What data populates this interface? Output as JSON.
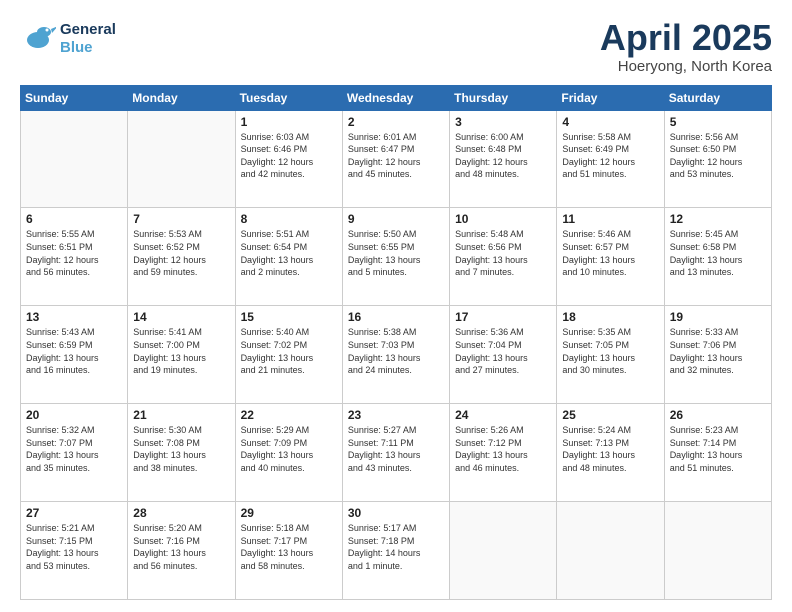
{
  "logo": {
    "line1": "General",
    "line2": "Blue"
  },
  "title": "April 2025",
  "subtitle": "Hoeryong, North Korea",
  "days_header": [
    "Sunday",
    "Monday",
    "Tuesday",
    "Wednesday",
    "Thursday",
    "Friday",
    "Saturday"
  ],
  "weeks": [
    [
      {
        "day": "",
        "info": ""
      },
      {
        "day": "",
        "info": ""
      },
      {
        "day": "1",
        "info": "Sunrise: 6:03 AM\nSunset: 6:46 PM\nDaylight: 12 hours\nand 42 minutes."
      },
      {
        "day": "2",
        "info": "Sunrise: 6:01 AM\nSunset: 6:47 PM\nDaylight: 12 hours\nand 45 minutes."
      },
      {
        "day": "3",
        "info": "Sunrise: 6:00 AM\nSunset: 6:48 PM\nDaylight: 12 hours\nand 48 minutes."
      },
      {
        "day": "4",
        "info": "Sunrise: 5:58 AM\nSunset: 6:49 PM\nDaylight: 12 hours\nand 51 minutes."
      },
      {
        "day": "5",
        "info": "Sunrise: 5:56 AM\nSunset: 6:50 PM\nDaylight: 12 hours\nand 53 minutes."
      }
    ],
    [
      {
        "day": "6",
        "info": "Sunrise: 5:55 AM\nSunset: 6:51 PM\nDaylight: 12 hours\nand 56 minutes."
      },
      {
        "day": "7",
        "info": "Sunrise: 5:53 AM\nSunset: 6:52 PM\nDaylight: 12 hours\nand 59 minutes."
      },
      {
        "day": "8",
        "info": "Sunrise: 5:51 AM\nSunset: 6:54 PM\nDaylight: 13 hours\nand 2 minutes."
      },
      {
        "day": "9",
        "info": "Sunrise: 5:50 AM\nSunset: 6:55 PM\nDaylight: 13 hours\nand 5 minutes."
      },
      {
        "day": "10",
        "info": "Sunrise: 5:48 AM\nSunset: 6:56 PM\nDaylight: 13 hours\nand 7 minutes."
      },
      {
        "day": "11",
        "info": "Sunrise: 5:46 AM\nSunset: 6:57 PM\nDaylight: 13 hours\nand 10 minutes."
      },
      {
        "day": "12",
        "info": "Sunrise: 5:45 AM\nSunset: 6:58 PM\nDaylight: 13 hours\nand 13 minutes."
      }
    ],
    [
      {
        "day": "13",
        "info": "Sunrise: 5:43 AM\nSunset: 6:59 PM\nDaylight: 13 hours\nand 16 minutes."
      },
      {
        "day": "14",
        "info": "Sunrise: 5:41 AM\nSunset: 7:00 PM\nDaylight: 13 hours\nand 19 minutes."
      },
      {
        "day": "15",
        "info": "Sunrise: 5:40 AM\nSunset: 7:02 PM\nDaylight: 13 hours\nand 21 minutes."
      },
      {
        "day": "16",
        "info": "Sunrise: 5:38 AM\nSunset: 7:03 PM\nDaylight: 13 hours\nand 24 minutes."
      },
      {
        "day": "17",
        "info": "Sunrise: 5:36 AM\nSunset: 7:04 PM\nDaylight: 13 hours\nand 27 minutes."
      },
      {
        "day": "18",
        "info": "Sunrise: 5:35 AM\nSunset: 7:05 PM\nDaylight: 13 hours\nand 30 minutes."
      },
      {
        "day": "19",
        "info": "Sunrise: 5:33 AM\nSunset: 7:06 PM\nDaylight: 13 hours\nand 32 minutes."
      }
    ],
    [
      {
        "day": "20",
        "info": "Sunrise: 5:32 AM\nSunset: 7:07 PM\nDaylight: 13 hours\nand 35 minutes."
      },
      {
        "day": "21",
        "info": "Sunrise: 5:30 AM\nSunset: 7:08 PM\nDaylight: 13 hours\nand 38 minutes."
      },
      {
        "day": "22",
        "info": "Sunrise: 5:29 AM\nSunset: 7:09 PM\nDaylight: 13 hours\nand 40 minutes."
      },
      {
        "day": "23",
        "info": "Sunrise: 5:27 AM\nSunset: 7:11 PM\nDaylight: 13 hours\nand 43 minutes."
      },
      {
        "day": "24",
        "info": "Sunrise: 5:26 AM\nSunset: 7:12 PM\nDaylight: 13 hours\nand 46 minutes."
      },
      {
        "day": "25",
        "info": "Sunrise: 5:24 AM\nSunset: 7:13 PM\nDaylight: 13 hours\nand 48 minutes."
      },
      {
        "day": "26",
        "info": "Sunrise: 5:23 AM\nSunset: 7:14 PM\nDaylight: 13 hours\nand 51 minutes."
      }
    ],
    [
      {
        "day": "27",
        "info": "Sunrise: 5:21 AM\nSunset: 7:15 PM\nDaylight: 13 hours\nand 53 minutes."
      },
      {
        "day": "28",
        "info": "Sunrise: 5:20 AM\nSunset: 7:16 PM\nDaylight: 13 hours\nand 56 minutes."
      },
      {
        "day": "29",
        "info": "Sunrise: 5:18 AM\nSunset: 7:17 PM\nDaylight: 13 hours\nand 58 minutes."
      },
      {
        "day": "30",
        "info": "Sunrise: 5:17 AM\nSunset: 7:18 PM\nDaylight: 14 hours\nand 1 minute."
      },
      {
        "day": "",
        "info": ""
      },
      {
        "day": "",
        "info": ""
      },
      {
        "day": "",
        "info": ""
      }
    ]
  ]
}
